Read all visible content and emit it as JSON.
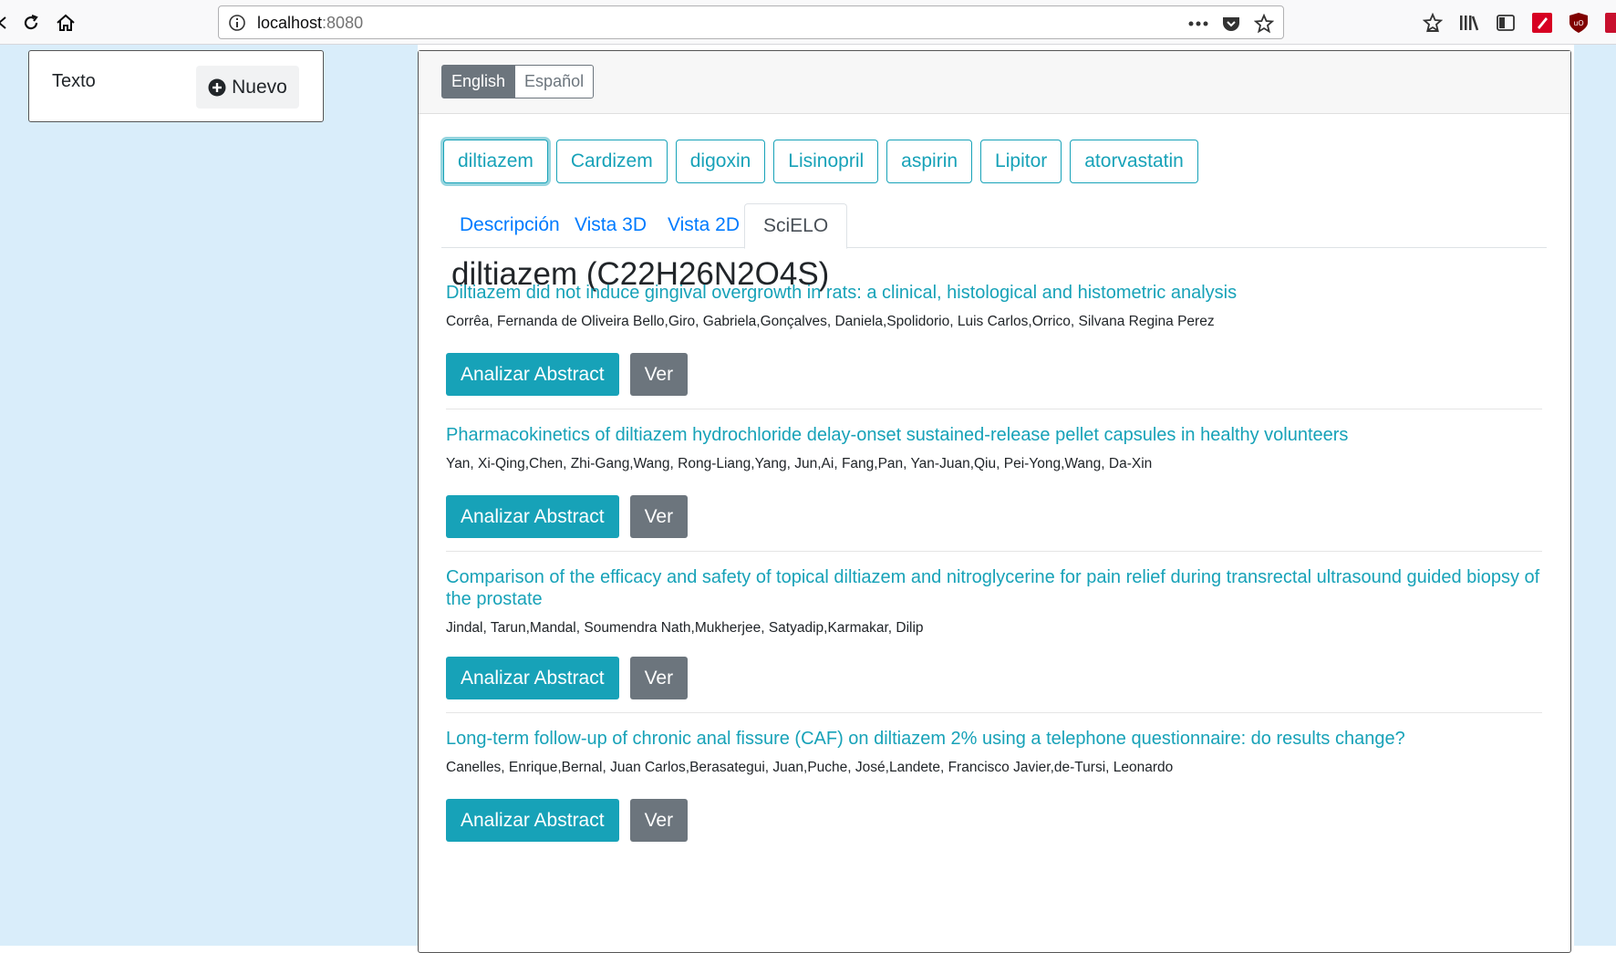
{
  "browser": {
    "url_host": "localhost",
    "url_port": ":8080"
  },
  "sidebar": {
    "label": "Texto",
    "new_button": "Nuevo"
  },
  "language": {
    "active": "English",
    "inactive": "Español"
  },
  "drugs": [
    "diltiazem",
    "Cardizem",
    "digoxin",
    "Lisinopril",
    "aspirin",
    "Lipitor",
    "atorvastatin"
  ],
  "tabs": {
    "descripcion": "Descripción",
    "vista3d": "Vista 3D",
    "vista2d": "Vista 2D",
    "scielo": "SciELO"
  },
  "drug_title": "diltiazem (C22H26N2O4S)",
  "buttons": {
    "analyze": "Analizar Abstract",
    "view": "Ver"
  },
  "articles": [
    {
      "title": "Diltiazem did not induce gingival overgrowth in rats: a clinical, histological and histometric analysis",
      "authors": "Corrêa, Fernanda de Oliveira Bello,Giro, Gabriela,Gonçalves, Daniela,Spolidorio, Luis Carlos,Orrico, Silvana Regina Perez"
    },
    {
      "title": "Pharmacokinetics of diltiazem hydrochloride delay-onset sustained-release pellet capsules in healthy volunteers",
      "authors": "Yan, Xi-Qing,Chen, Zhi-Gang,Wang, Rong-Liang,Yang, Jun,Ai, Fang,Pan, Yan-Juan,Qiu, Pei-Yong,Wang, Da-Xin"
    },
    {
      "title": "Comparison of the efficacy and safety of topical diltiazem and nitroglycerine for pain relief during transrectal ultrasound guided biopsy of the prostate",
      "authors": "Jindal, Tarun,Mandal, Soumendra Nath,Mukherjee, Satyadip,Karmakar, Dilip"
    },
    {
      "title": "Long-term follow-up of chronic anal fissure (CAF) on diltiazem 2% using a telephone questionnaire: do results change?",
      "authors": "Canelles, Enrique,Bernal, Juan Carlos,Berasategui, Juan,Puche, José,Landete, Francisco Javier,de-Tursi, Leonardo"
    }
  ]
}
